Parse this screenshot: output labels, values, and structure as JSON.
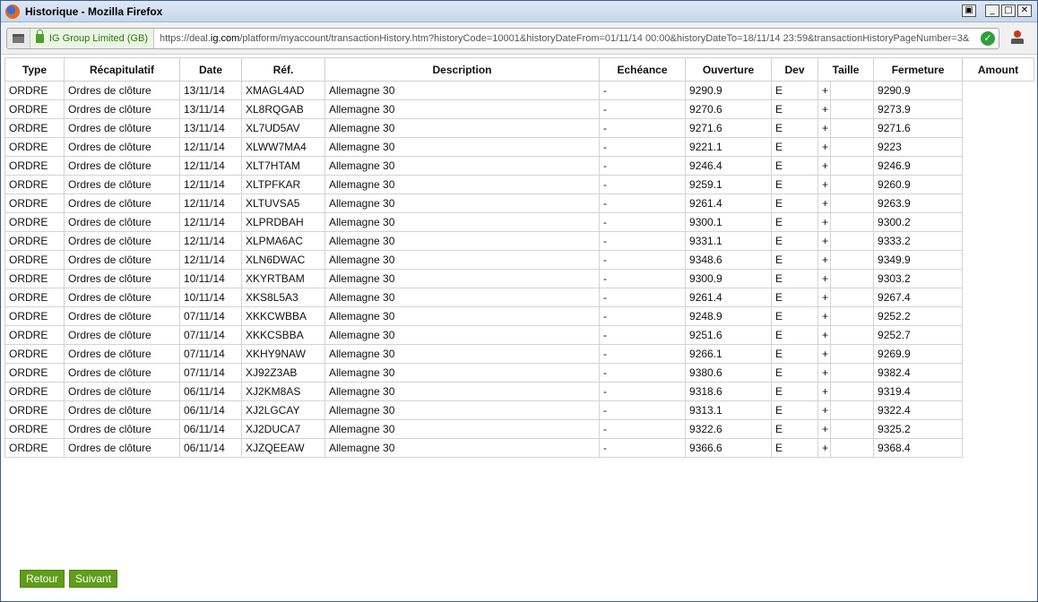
{
  "window": {
    "title": "Historique - Mozilla Firefox"
  },
  "browser": {
    "identity": "IG Group Limited (GB)",
    "url_prefix": "https://deal.",
    "url_domain": "ig.com",
    "url_rest": "/platform/myaccount/transactionHistory.htm?historyCode=10001&historyDateFrom=01/11/14 00:00&historyDateTo=18/11/14 23:59&transactionHistoryPageNumber=3&"
  },
  "table": {
    "headers": {
      "type": "Type",
      "recap": "Récapitulatif",
      "date": "Date",
      "ref": "Réf.",
      "description": "Description",
      "echeance": "Echéance",
      "ouverture": "Ouverture",
      "dev": "Dev",
      "taille": "Taille",
      "fermeture": "Fermeture",
      "amount": "Amount"
    },
    "rows": [
      {
        "type": "ORDRE",
        "recap": "Ordres de clôture",
        "date": "13/11/14",
        "ref": "XMAGL4AD",
        "desc": "Allemagne 30",
        "ech": "-",
        "ouv": "9290.9",
        "dev": "E",
        "taille": "+",
        "ferm": "9290.9"
      },
      {
        "type": "ORDRE",
        "recap": "Ordres de clôture",
        "date": "13/11/14",
        "ref": "XL8RQGAB",
        "desc": "Allemagne 30",
        "ech": "-",
        "ouv": "9270.6",
        "dev": "E",
        "taille": "+",
        "ferm": "9273.9"
      },
      {
        "type": "ORDRE",
        "recap": "Ordres de clôture",
        "date": "13/11/14",
        "ref": "XL7UD5AV",
        "desc": "Allemagne 30",
        "ech": "-",
        "ouv": "9271.6",
        "dev": "E",
        "taille": "+",
        "ferm": "9271.6"
      },
      {
        "type": "ORDRE",
        "recap": "Ordres de clôture",
        "date": "12/11/14",
        "ref": "XLWW7MA4",
        "desc": "Allemagne 30",
        "ech": "-",
        "ouv": "9221.1",
        "dev": "E",
        "taille": "+",
        "ferm": "9223"
      },
      {
        "type": "ORDRE",
        "recap": "Ordres de clôture",
        "date": "12/11/14",
        "ref": "XLT7HTAM",
        "desc": "Allemagne 30",
        "ech": "-",
        "ouv": "9246.4",
        "dev": "E",
        "taille": "+",
        "ferm": "9246.9"
      },
      {
        "type": "ORDRE",
        "recap": "Ordres de clôture",
        "date": "12/11/14",
        "ref": "XLTPFKAR",
        "desc": "Allemagne 30",
        "ech": "-",
        "ouv": "9259.1",
        "dev": "E",
        "taille": "+",
        "ferm": "9260.9"
      },
      {
        "type": "ORDRE",
        "recap": "Ordres de clôture",
        "date": "12/11/14",
        "ref": "XLTUVSA5",
        "desc": "Allemagne 30",
        "ech": "-",
        "ouv": "9261.4",
        "dev": "E",
        "taille": "+",
        "ferm": "9263.9"
      },
      {
        "type": "ORDRE",
        "recap": "Ordres de clôture",
        "date": "12/11/14",
        "ref": "XLPRDBAH",
        "desc": "Allemagne 30",
        "ech": "-",
        "ouv": "9300.1",
        "dev": "E",
        "taille": "+",
        "ferm": "9300.2"
      },
      {
        "type": "ORDRE",
        "recap": "Ordres de clôture",
        "date": "12/11/14",
        "ref": "XLPMA6AC",
        "desc": "Allemagne 30",
        "ech": "-",
        "ouv": "9331.1",
        "dev": "E",
        "taille": "+",
        "ferm": "9333.2"
      },
      {
        "type": "ORDRE",
        "recap": "Ordres de clôture",
        "date": "12/11/14",
        "ref": "XLN6DWAC",
        "desc": "Allemagne 30",
        "ech": "-",
        "ouv": "9348.6",
        "dev": "E",
        "taille": "+",
        "ferm": "9349.9"
      },
      {
        "type": "ORDRE",
        "recap": "Ordres de clôture",
        "date": "10/11/14",
        "ref": "XKYRTBAM",
        "desc": "Allemagne 30",
        "ech": "-",
        "ouv": "9300.9",
        "dev": "E",
        "taille": "+",
        "ferm": "9303.2"
      },
      {
        "type": "ORDRE",
        "recap": "Ordres de clôture",
        "date": "10/11/14",
        "ref": "XKS8L5A3",
        "desc": "Allemagne 30",
        "ech": "-",
        "ouv": "9261.4",
        "dev": "E",
        "taille": "+",
        "ferm": "9267.4"
      },
      {
        "type": "ORDRE",
        "recap": "Ordres de clôture",
        "date": "07/11/14",
        "ref": "XKKCWBBA",
        "desc": "Allemagne 30",
        "ech": "-",
        "ouv": "9248.9",
        "dev": "E",
        "taille": "+",
        "ferm": "9252.2"
      },
      {
        "type": "ORDRE",
        "recap": "Ordres de clôture",
        "date": "07/11/14",
        "ref": "XKKCSBBA",
        "desc": "Allemagne 30",
        "ech": "-",
        "ouv": "9251.6",
        "dev": "E",
        "taille": "+",
        "ferm": "9252.7"
      },
      {
        "type": "ORDRE",
        "recap": "Ordres de clôture",
        "date": "07/11/14",
        "ref": "XKHY9NAW",
        "desc": "Allemagne 30",
        "ech": "-",
        "ouv": "9266.1",
        "dev": "E",
        "taille": "+",
        "ferm": "9269.9"
      },
      {
        "type": "ORDRE",
        "recap": "Ordres de clôture",
        "date": "07/11/14",
        "ref": "XJ92Z3AB",
        "desc": "Allemagne 30",
        "ech": "-",
        "ouv": "9380.6",
        "dev": "E",
        "taille": "+",
        "ferm": "9382.4"
      },
      {
        "type": "ORDRE",
        "recap": "Ordres de clôture",
        "date": "06/11/14",
        "ref": "XJ2KM8AS",
        "desc": "Allemagne 30",
        "ech": "-",
        "ouv": "9318.6",
        "dev": "E",
        "taille": "+",
        "ferm": "9319.4"
      },
      {
        "type": "ORDRE",
        "recap": "Ordres de clôture",
        "date": "06/11/14",
        "ref": "XJ2LGCAY",
        "desc": "Allemagne 30",
        "ech": "-",
        "ouv": "9313.1",
        "dev": "E",
        "taille": "+",
        "ferm": "9322.4"
      },
      {
        "type": "ORDRE",
        "recap": "Ordres de clôture",
        "date": "06/11/14",
        "ref": "XJ2DUCA7",
        "desc": "Allemagne 30",
        "ech": "-",
        "ouv": "9322.6",
        "dev": "E",
        "taille": "+",
        "ferm": "9325.2"
      },
      {
        "type": "ORDRE",
        "recap": "Ordres de clôture",
        "date": "06/11/14",
        "ref": "XJZQEEAW",
        "desc": "Allemagne 30",
        "ech": "-",
        "ouv": "9366.6",
        "dev": "E",
        "taille": "+",
        "ferm": "9368.4"
      }
    ]
  },
  "buttons": {
    "back": "Retour",
    "next": "Suivant"
  }
}
